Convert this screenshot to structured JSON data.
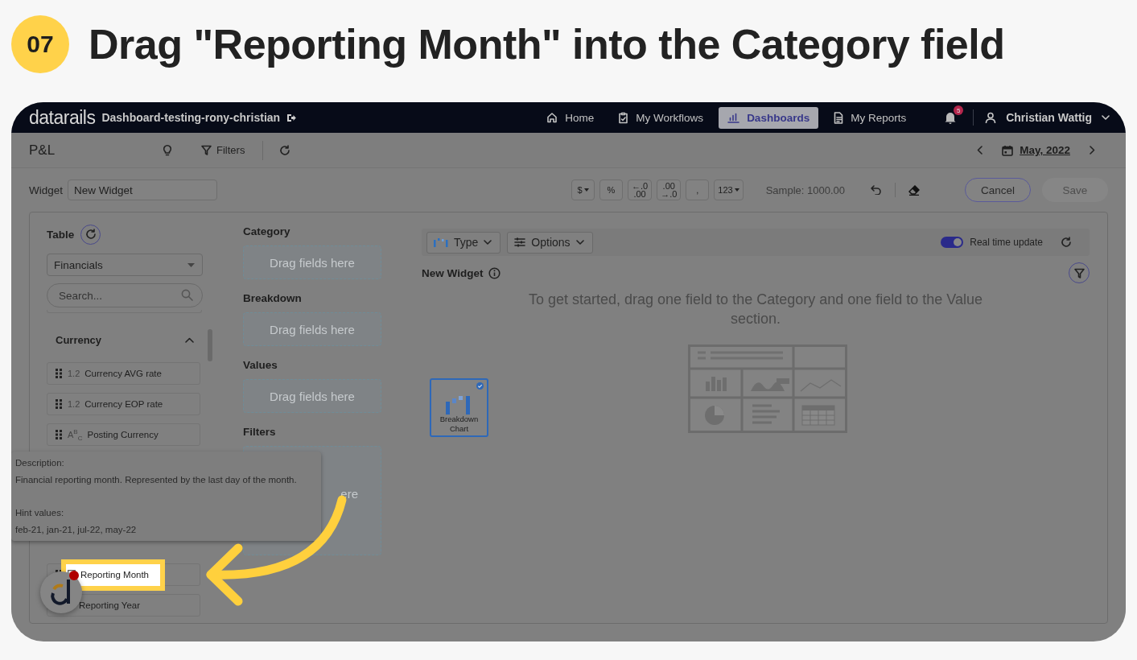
{
  "step": {
    "number": "07",
    "title": "Drag \"Reporting Month\" into the Category field"
  },
  "app": {
    "logo": "datarails",
    "dashboard_name": "Dashboard-testing-rony-christian",
    "nav": [
      {
        "label": "Home",
        "selected": false
      },
      {
        "label": "My Workflows",
        "selected": false
      },
      {
        "label": "Dashboards",
        "selected": true
      },
      {
        "label": "My Reports",
        "selected": false
      }
    ],
    "notifications": "5",
    "user": "Christian Wattig"
  },
  "toolbar": {
    "title": "P&L",
    "filters": "Filters",
    "date": "May, 2022"
  },
  "widget_bar": {
    "label": "Widget",
    "name": "New Widget",
    "format_buttons": [
      {
        "lines": [
          "$"
        ],
        "dropdown": true
      },
      {
        "lines": [
          "%"
        ],
        "dropdown": false
      },
      {
        "lines": [
          "←.0",
          ".00"
        ],
        "dropdown": false
      },
      {
        "lines": [
          ".00",
          "→.0"
        ],
        "dropdown": false
      },
      {
        "lines": [
          ","
        ],
        "dropdown": false
      },
      {
        "lines": [
          "123"
        ],
        "dropdown": true
      }
    ],
    "sample": "Sample: 1000.00",
    "cancel": "Cancel",
    "save": "Save",
    "save_disabled": true
  },
  "fields_panel": {
    "label": "Table",
    "table": "Financials",
    "search_placeholder": "Search...",
    "section": {
      "label": "Currency",
      "expanded": true
    },
    "items": [
      {
        "kind": "number",
        "type_mark": "1.2",
        "label": "Currency AVG rate",
        "highlighted": false
      },
      {
        "kind": "number",
        "type_mark": "1.2",
        "label": "Currency EOP rate",
        "highlighted": false
      },
      {
        "kind": "text",
        "type_mark": "A$^{B}$$_{C}$",
        "label": "Posting Currency",
        "highlighted": false
      }
    ],
    "bottom_items": [
      {
        "kind": "date",
        "label": "Reporting Month",
        "highlighted": true
      },
      {
        "kind": "hidden",
        "label": "Reporting Year",
        "highlighted": false
      }
    ]
  },
  "drop_zones": [
    {
      "label": "Category",
      "placeholder": "Drag fields here"
    },
    {
      "label": "Breakdown",
      "placeholder": "Drag fields here"
    },
    {
      "label": "Values",
      "placeholder": "Drag fields here"
    },
    {
      "label": "Filters",
      "placeholder": "ere"
    }
  ],
  "tooltip": {
    "description_label": "Description:",
    "description": "Financial reporting month. Represented by the last day of the month.",
    "hint_label": "Hint values:",
    "hints": "feb-21, jan-21, jul-22, may-22"
  },
  "chart_area": {
    "type_button": "Type",
    "options_button": "Options",
    "realtime": {
      "label": "Real time update",
      "on": true
    },
    "title": "New Widget",
    "message": "To get started, drag one field to the Category and one field to the Value section.",
    "chart_types": [
      {
        "label": "Breakdown Chart",
        "selected": true
      }
    ]
  }
}
